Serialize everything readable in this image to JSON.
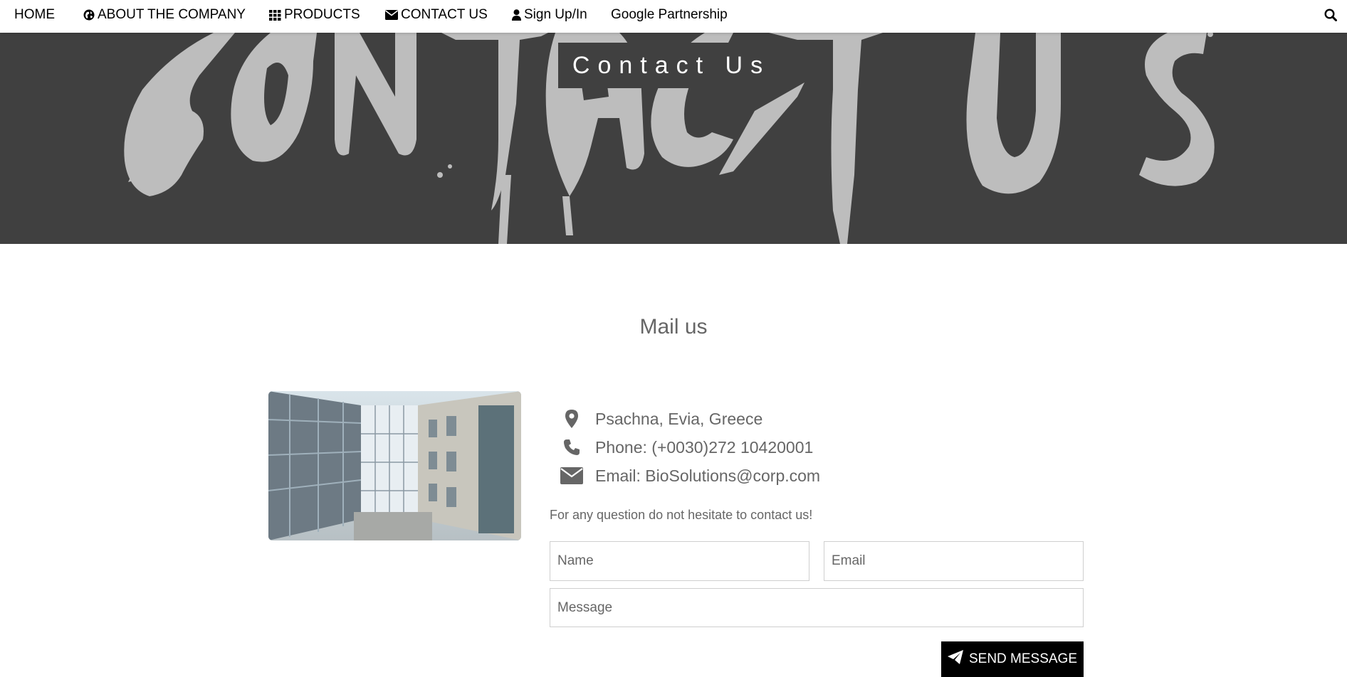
{
  "nav": {
    "items": [
      {
        "label": "HOME",
        "icon": ""
      },
      {
        "label": "ABOUT THE COMPANY",
        "icon": "globe-icon"
      },
      {
        "label": "PRODUCTS",
        "icon": "grid-icon"
      },
      {
        "label": "CONTACT US",
        "icon": "envelope-icon"
      },
      {
        "label": "Sign Up/In",
        "icon": "user-icon"
      },
      {
        "label": "Google Partnership",
        "icon": ""
      }
    ],
    "search_icon": "search-icon"
  },
  "hero": {
    "title": "Contact Us",
    "background_art_text": "CONTACT US",
    "background_color": "#404040",
    "art_color": "#bdbdbd"
  },
  "main": {
    "section_title": "Mail us",
    "contact": {
      "address": "Psachna, Evia, Greece",
      "phone": "Phone: (+0030)272 10420001",
      "email": "Email: BioSolutions@corp.com"
    },
    "hint": "For any question do not hesitate to contact us!",
    "form": {
      "name_placeholder": "Name",
      "email_placeholder": "Email",
      "message_placeholder": "Message",
      "send_label": "SEND MESSAGE"
    }
  },
  "colors": {
    "text_muted": "#666666",
    "button_bg": "#000000"
  }
}
